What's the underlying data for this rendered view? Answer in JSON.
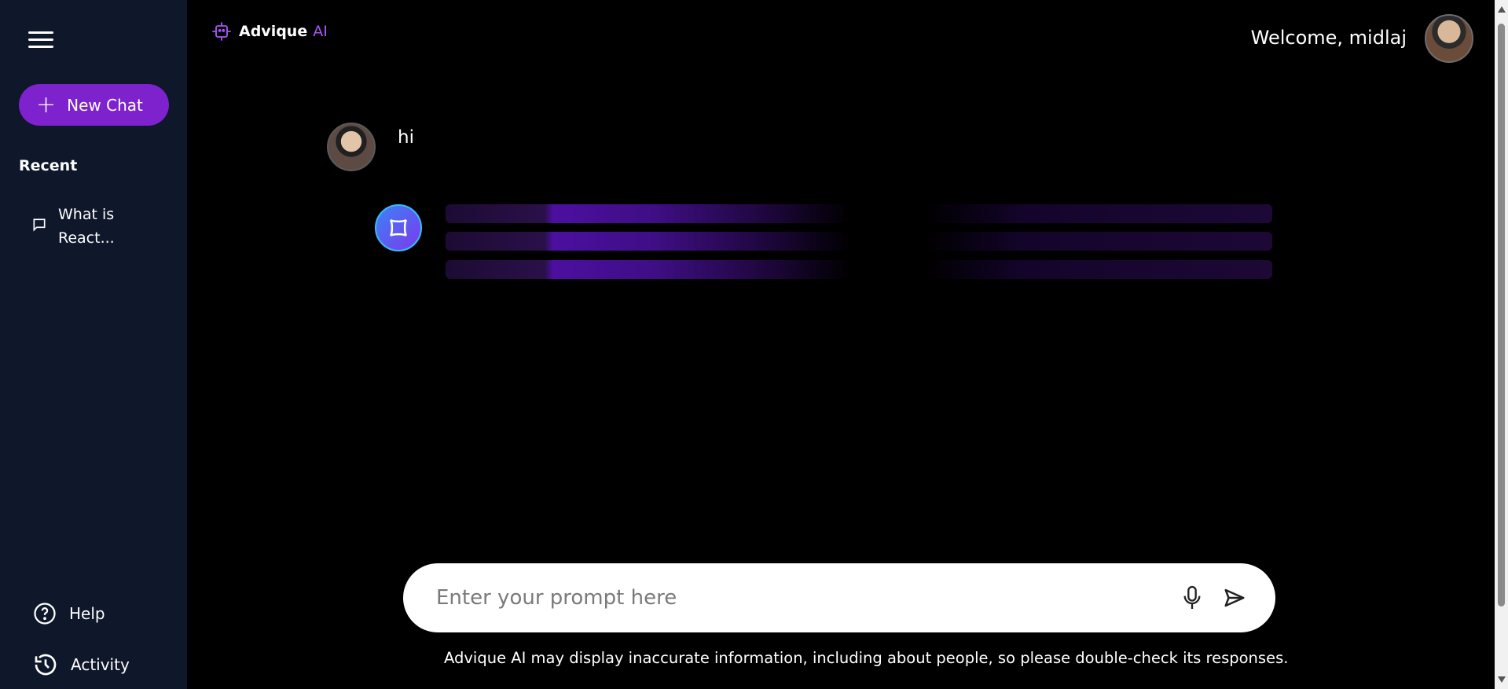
{
  "sidebar": {
    "new_chat_label": "New Chat",
    "recent_title": "Recent",
    "recent_items": [
      {
        "label": "What is React..."
      }
    ],
    "help_label": "Help",
    "activity_label": "Activity"
  },
  "header": {
    "brand_name": "Advique",
    "brand_suffix": "AI",
    "welcome_text": "Welcome, midlaj"
  },
  "chat": {
    "user_message": "hi"
  },
  "input": {
    "placeholder": "Enter your prompt here"
  },
  "footer": {
    "disclaimer": "Advique AI may display inaccurate information, including about people, so please double-check its responses."
  },
  "colors": {
    "accent": "#7e22ce",
    "sidebar_bg": "#0f172a",
    "brand_ai": "#a855f7"
  },
  "icons": [
    "menu-icon",
    "plus-icon",
    "chat-bubble-icon",
    "help-icon",
    "history-icon",
    "logo-icon",
    "bot-icon",
    "microphone-icon",
    "send-icon"
  ]
}
